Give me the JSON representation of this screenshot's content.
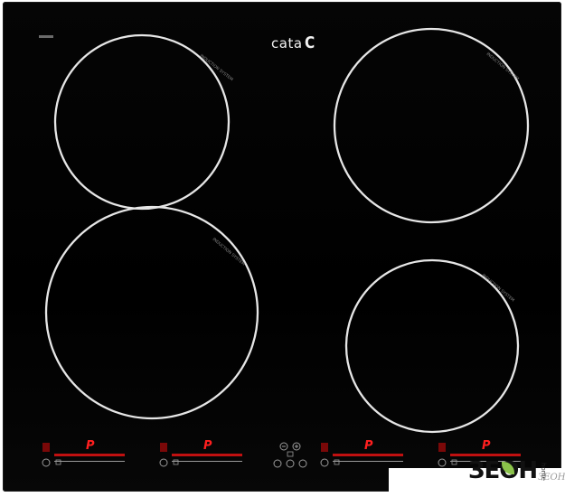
{
  "brand": {
    "name": "cata",
    "mark": "C"
  },
  "zones": [
    {
      "id": "rear-left",
      "label": "INDUCTION SYSTEM"
    },
    {
      "id": "rear-right",
      "label": "INDUCTION SYSTEM"
    },
    {
      "id": "front-left",
      "label": "INDUCTION SYSTEM"
    },
    {
      "id": "front-right",
      "label": "INDUCTION SYSTEM"
    }
  ],
  "controls": {
    "power_symbol": "P",
    "zone_panels": 4,
    "slider_min": "-",
    "slider_max": "P",
    "center_icons": [
      "minus-icon",
      "plus-icon",
      "timer-icon",
      "power-icon",
      "info-icon",
      "lock-icon"
    ]
  },
  "watermark": {
    "text": "ЗЕОН",
    "side": "home",
    "sub": "ЗЕОН+"
  },
  "colors": {
    "glass": "#000000",
    "zone_ring": "#e6e6e6",
    "display_red": "#ff1f1f",
    "icon_gray": "#9a9a9a",
    "leaf_green": "#8bc34a"
  }
}
